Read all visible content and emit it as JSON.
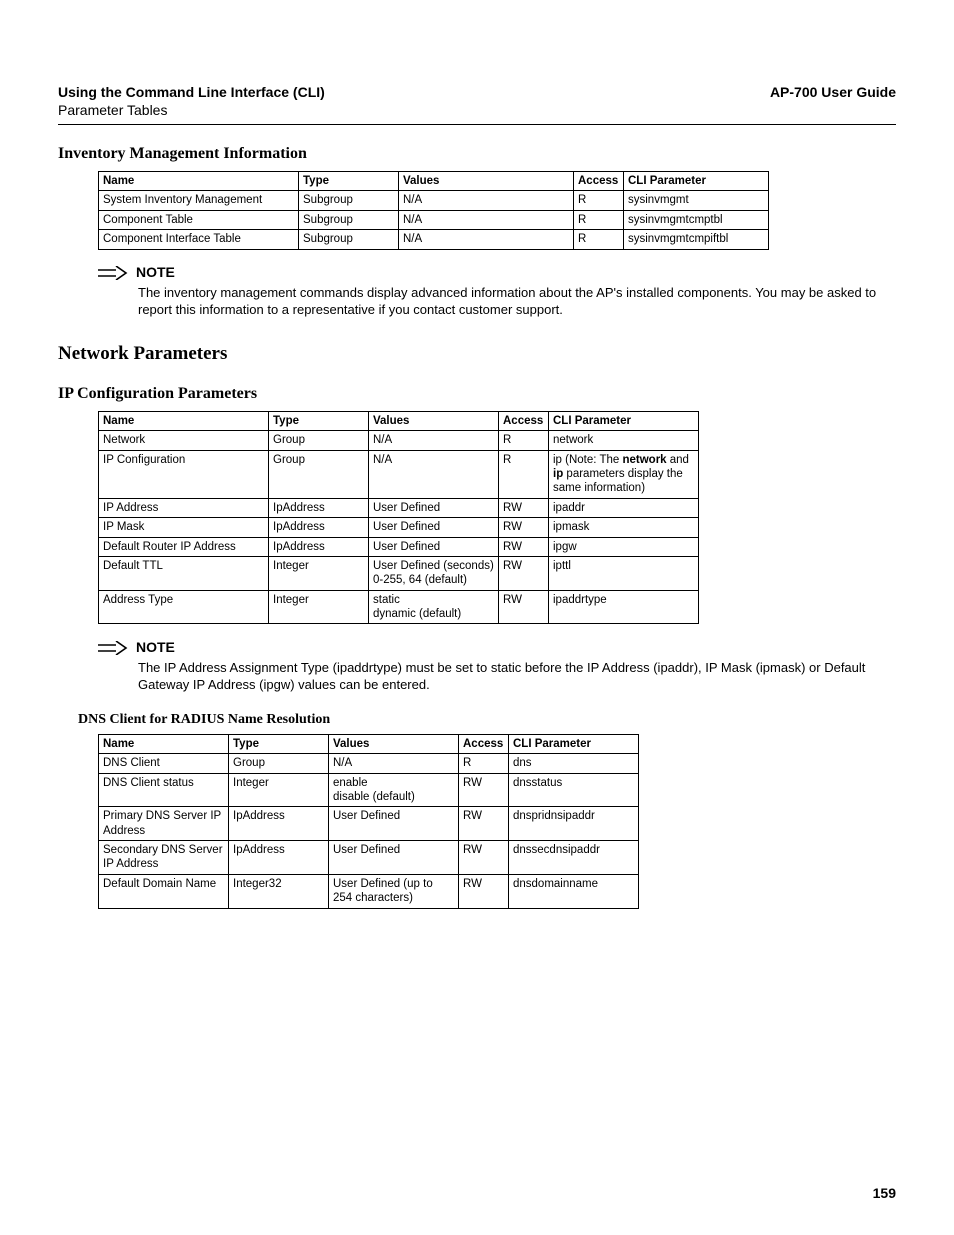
{
  "header": {
    "left_bold": "Using the Command Line Interface (CLI)",
    "left_sub": "Parameter Tables",
    "right": "AP-700 User Guide"
  },
  "section1": {
    "title": "Inventory Management Information",
    "cols": [
      "Name",
      "Type",
      "Values",
      "Access",
      "CLI Parameter"
    ],
    "rows": [
      [
        "System Inventory Management",
        "Subgroup",
        "N/A",
        "R",
        "sysinvmgmt"
      ],
      [
        "Component Table",
        "Subgroup",
        "N/A",
        "R",
        "sysinvmgmtcmptbl"
      ],
      [
        "Component Interface Table",
        "Subgroup",
        "N/A",
        "R",
        "sysinvmgmtcmpiftbl"
      ]
    ]
  },
  "note1": {
    "label": "NOTE",
    "text": "The inventory management commands display advanced information about the AP's installed components. You may be asked to report this information to a representative if you contact customer support."
  },
  "section2_title": "Network Parameters",
  "section3": {
    "title": "IP Configuration Parameters",
    "cols": [
      "Name",
      "Type",
      "Values",
      "Access",
      "CLI Parameter"
    ],
    "rows": [
      {
        "c": [
          "Network",
          "Group",
          "N/A",
          "R",
          "network"
        ]
      },
      {
        "c": [
          "IP Configuration",
          "Group",
          "N/A",
          "R",
          ""
        ],
        "cli_html": "ip (Note: The <b>network</b> and <b>ip</b> parameters display the same information)"
      },
      {
        "c": [
          "IP Address",
          "IpAddress",
          "User Defined",
          "RW",
          "ipaddr"
        ]
      },
      {
        "c": [
          "IP Mask",
          "IpAddress",
          "User Defined",
          "RW",
          "ipmask"
        ]
      },
      {
        "c": [
          "Default Router IP Address",
          "IpAddress",
          "User Defined",
          "RW",
          "ipgw"
        ]
      },
      {
        "c": [
          "Default TTL",
          "Integer",
          "User Defined (seconds) 0-255, 64 (default)",
          "RW",
          "ipttl"
        ]
      },
      {
        "c": [
          "Address Type",
          "Integer",
          "static\ndynamic (default)",
          "RW",
          "ipaddrtype"
        ]
      }
    ]
  },
  "note2": {
    "label": "NOTE",
    "text": "The IP Address Assignment Type (ipaddrtype) must be set to static before the IP Address (ipaddr), IP Mask (ipmask) or Default Gateway IP Address (ipgw) values can be entered."
  },
  "section4": {
    "title": "DNS Client for RADIUS Name Resolution",
    "cols": [
      "Name",
      "Type",
      "Values",
      "Access",
      "CLI Parameter"
    ],
    "rows": [
      [
        "DNS Client",
        "Group",
        "N/A",
        "R",
        "dns"
      ],
      [
        "DNS Client status",
        "Integer",
        "enable\ndisable (default)",
        "RW",
        "dnsstatus"
      ],
      [
        "Primary DNS Server IP Address",
        "IpAddress",
        "User Defined",
        "RW",
        "dnspridnsipaddr"
      ],
      [
        "Secondary DNS Server IP Address",
        "IpAddress",
        "User Defined",
        "RW",
        "dnssecdnsipaddr"
      ],
      [
        "Default Domain Name",
        "Integer32",
        "User Defined (up to 254 characters)",
        "RW",
        "dnsdomainname"
      ]
    ]
  },
  "page_number": "159",
  "table_widths": {
    "t1": [
      200,
      100,
      175,
      50,
      145
    ],
    "t2": [
      170,
      100,
      130,
      50,
      150
    ],
    "t3": [
      130,
      100,
      130,
      50,
      130
    ]
  }
}
